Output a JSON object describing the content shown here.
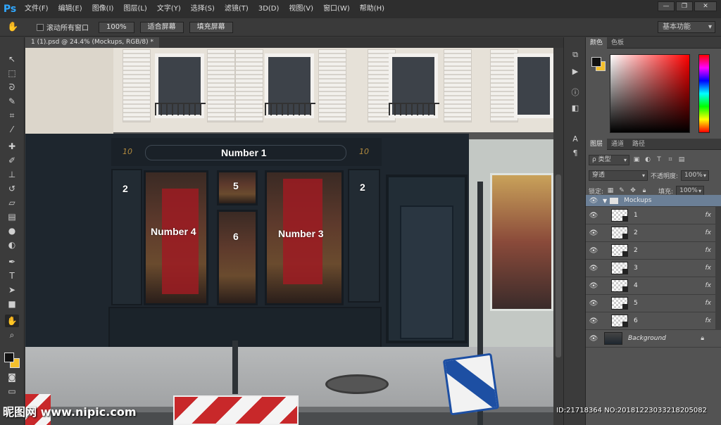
{
  "app": {
    "logo": "Ps",
    "menu": [
      "文件(F)",
      "编辑(E)",
      "图像(I)",
      "图层(L)",
      "文字(Y)",
      "选择(S)",
      "滤镜(T)",
      "3D(D)",
      "视图(V)",
      "窗口(W)",
      "帮助(H)"
    ],
    "window_controls": {
      "minimize": "—",
      "restore": "❐",
      "close": "✕"
    }
  },
  "options_bar": {
    "scroll_all_label": "滚动所有窗口",
    "zoom_100": "100%",
    "fit_screen": "适合屏幕",
    "fill_screen": "填充屏幕",
    "workspace": "基本功能"
  },
  "document": {
    "tab_title": "1 (1).psd @ 24.4% (Mockups, RGB/8) *"
  },
  "scene": {
    "sign_text": "Number 1",
    "shop_number_left": "10",
    "shop_number_right": "10",
    "labels": {
      "n2_left": "2",
      "n2_right": "2",
      "n5": "5",
      "n4": "Number 4",
      "n6": "6",
      "n3": "Number 3"
    }
  },
  "color_panel": {
    "tabs": [
      "颜色",
      "色板"
    ],
    "foreground": "#111111",
    "background": "#f4c02c"
  },
  "layers_panel": {
    "tabs": [
      "图层",
      "通道",
      "路径"
    ],
    "filter_kind": "ρ 类型",
    "blend_mode": "穿透",
    "opacity_label": "不透明度:",
    "opacity_value": "100%",
    "lock_label": "锁定:",
    "fill_label": "填充:",
    "fill_value": "100%",
    "group_name": "Mockups",
    "layers": [
      {
        "name": "1",
        "fx": "fx"
      },
      {
        "name": "2",
        "fx": "fx"
      },
      {
        "name": "2",
        "fx": "fx"
      },
      {
        "name": "3",
        "fx": "fx"
      },
      {
        "name": "4",
        "fx": "fx"
      },
      {
        "name": "5",
        "fx": "fx"
      },
      {
        "name": "6",
        "fx": "fx"
      }
    ],
    "background_layer": "Background"
  },
  "overlay": {
    "watermark": "昵图网 www.nipic.com",
    "id_line": "ID:21718364 NO:20181223033218205082"
  }
}
